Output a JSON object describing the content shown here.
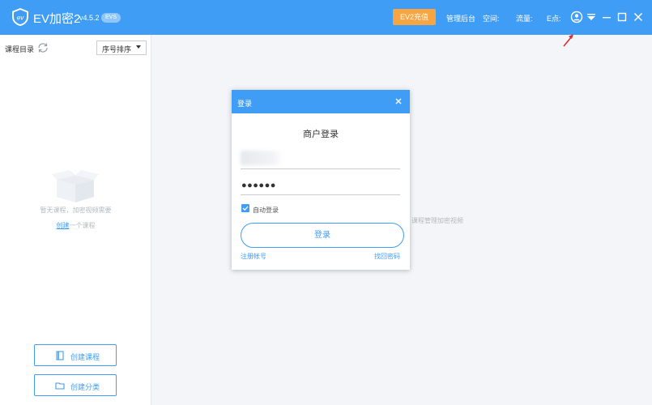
{
  "header": {
    "app_name": "EV加密2",
    "version": "v4.5.2",
    "badge": "EVS",
    "recharge_label": "EV2充值",
    "links": {
      "admin": "管理后台",
      "space": "空间:",
      "traffic": "流量:",
      "points": "E点:"
    },
    "icons": [
      "user-circle-icon",
      "dropdown-icon",
      "minimize-icon",
      "maximize-icon",
      "close-icon"
    ],
    "accent_color": "#3f9df6",
    "recharge_color": "#f6a542"
  },
  "sidebar": {
    "title": "课程目录",
    "sort_label": "序号排序",
    "empty_text": "暂无课程，加密视频需要",
    "empty_link": "创建",
    "empty_suffix": "一个课程",
    "buttons": {
      "create_course": "创建课程",
      "create_category": "创建分类"
    }
  },
  "main": {
    "hint": "课程管理加密视频"
  },
  "dialog": {
    "title": "登录",
    "heading": "商户登录",
    "password_mask": "●●●●●●",
    "auto_login_label": "自动登录",
    "auto_login_checked": true,
    "login_button": "登录",
    "register_link": "注册帐号",
    "forgot_link": "找回密码"
  }
}
